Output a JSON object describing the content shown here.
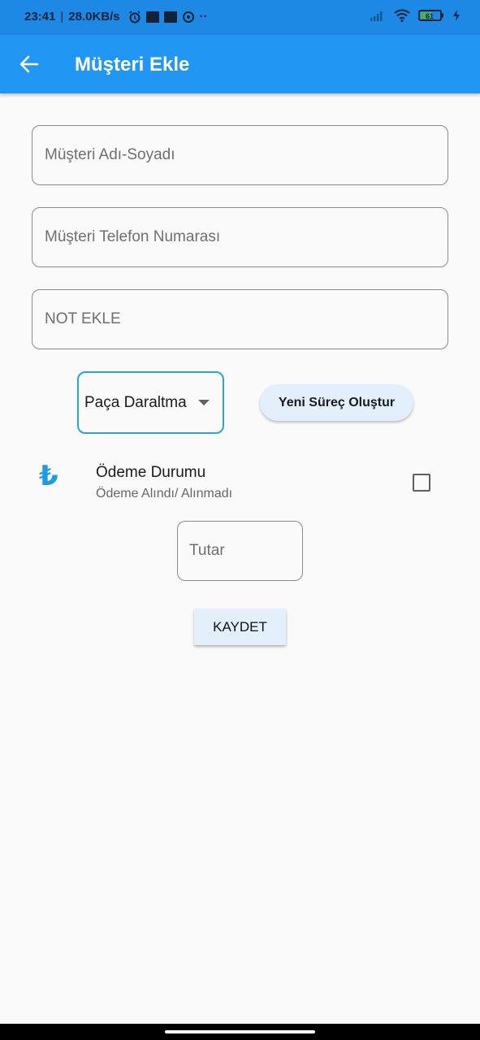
{
  "status_bar": {
    "time": "23:41",
    "network_speed": "28.0KB/s",
    "more_indicator": "··",
    "battery_level": "61",
    "icons": [
      "alarm-icon",
      "notification-icon",
      "notification-icon",
      "sync-icon",
      "signal-icon",
      "wifi-icon",
      "battery-icon",
      "charging-icon"
    ]
  },
  "app_bar": {
    "title": "Müşteri Ekle",
    "back_icon": "arrow-left-icon"
  },
  "form": {
    "name_placeholder": "Müşteri Adı-Soyadı",
    "phone_placeholder": "Müşteri Telefon Numarası",
    "note_placeholder": "NOT EKLE",
    "process_dropdown": {
      "selected": "Paça Daraltma"
    },
    "new_process_button": "Yeni Süreç Oluştur",
    "payment": {
      "icon": "turkish-lira-icon",
      "symbol": "₺",
      "title": "Ödeme Durumu",
      "subtitle": "Ödeme Alındı/ Alınmadı",
      "checked": false
    },
    "amount_placeholder": "Tutar",
    "save_button": "KAYDET"
  },
  "colors": {
    "status_bar": "#1e88e5",
    "app_bar": "#2196f3",
    "accent": "#29a4dc",
    "button_bg": "#e3f0fc",
    "background": "#fafafa"
  }
}
